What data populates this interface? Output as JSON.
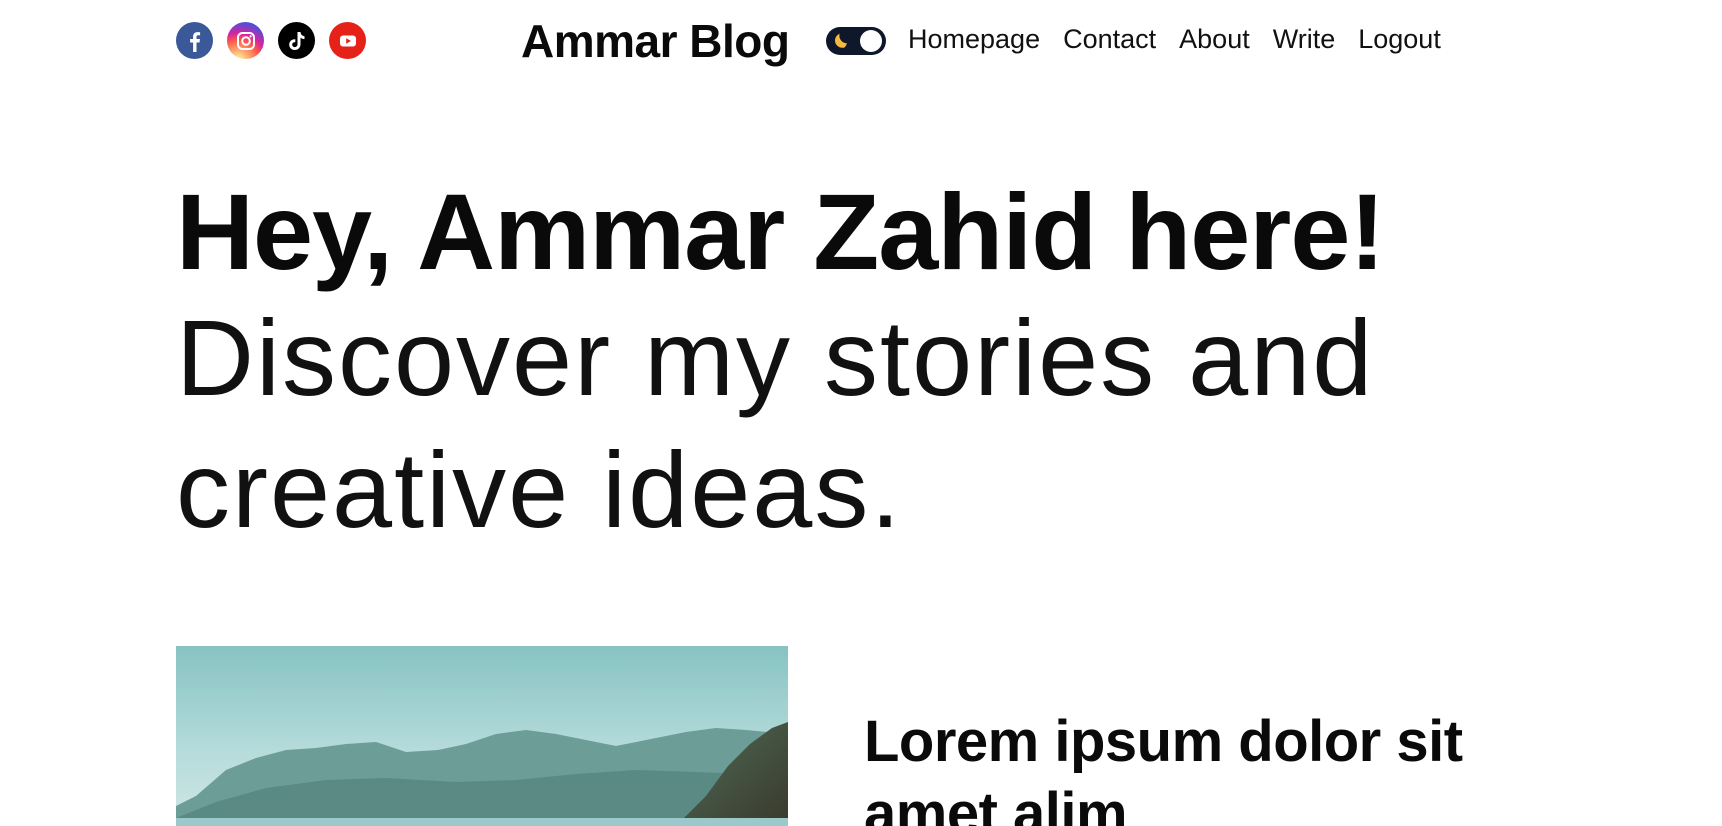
{
  "navbar": {
    "social": [
      {
        "name": "facebook-icon",
        "color": "#3b5998"
      },
      {
        "name": "instagram-icon",
        "color": "#d6249f"
      },
      {
        "name": "tiktok-icon",
        "color": "#000000"
      },
      {
        "name": "youtube-icon",
        "color": "#e62117"
      }
    ],
    "logo": "Ammar Blog",
    "theme_toggle": {
      "icon": "moon-icon",
      "state": "dark",
      "track_color": "#0f172a",
      "moon_color": "#f5b941"
    },
    "links": [
      "Homepage",
      "Contact",
      "About",
      "Write",
      "Logout"
    ]
  },
  "hero": {
    "greeting": "Hey, Ammar Zahid here!",
    "tagline": "Discover my stories and creative ideas."
  },
  "featured": {
    "image": "coastal-landscape-image",
    "title": "Lorem ipsum dolor sit amet alim"
  }
}
